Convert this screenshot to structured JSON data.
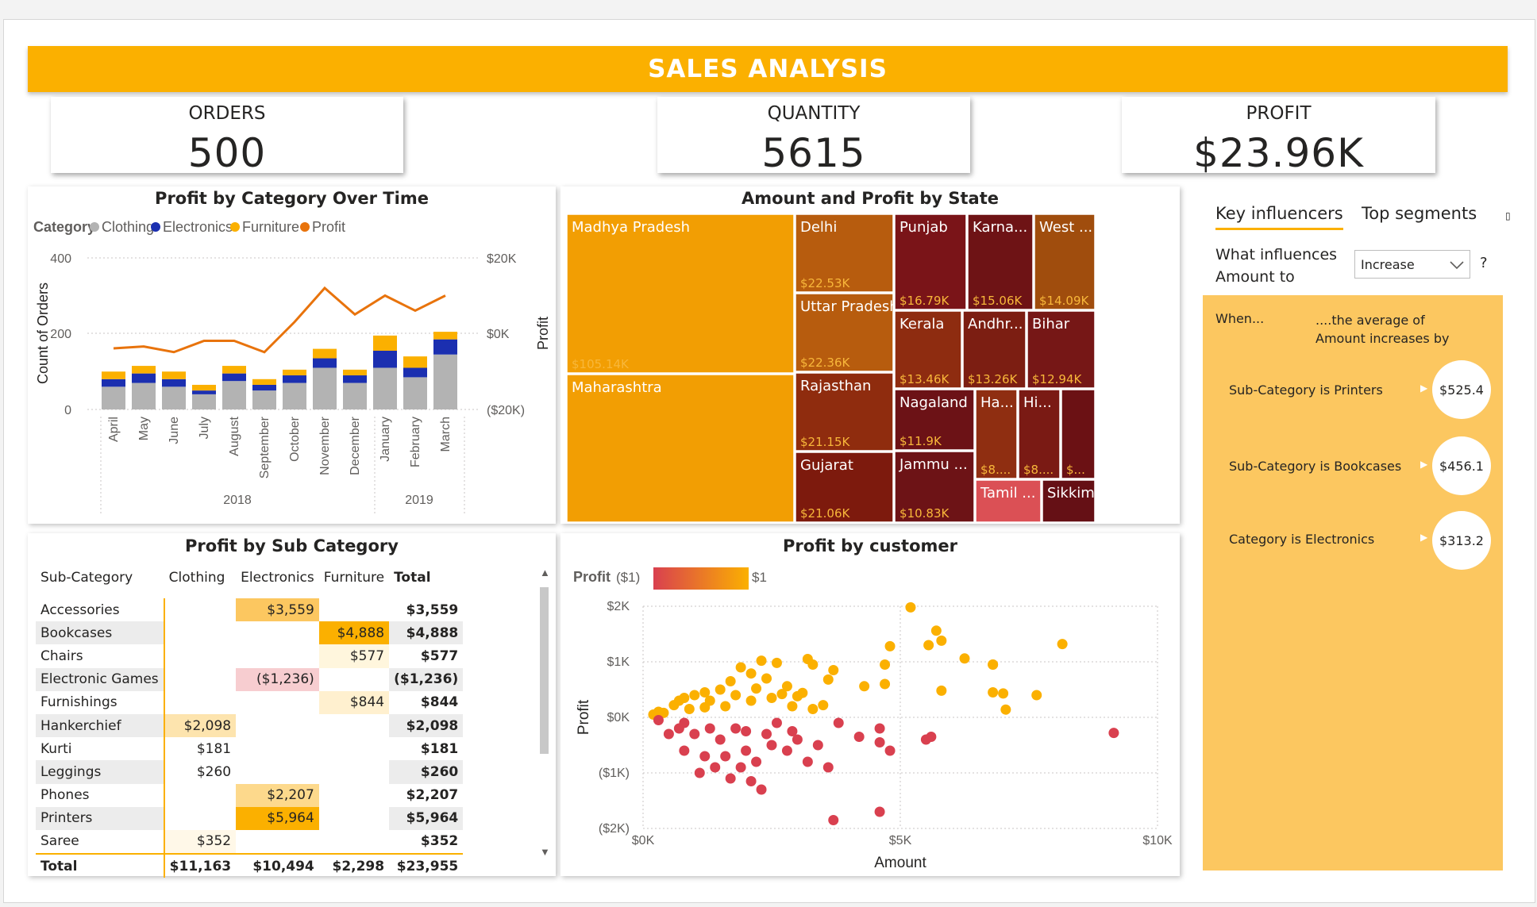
{
  "header": {
    "title": "SALES ANALYSIS"
  },
  "kpis": [
    {
      "label": "ORDERS",
      "value": "500"
    },
    {
      "label": "QUANTITY",
      "value": "5615"
    },
    {
      "label": "PROFIT",
      "value": "$23.96K"
    }
  ],
  "combo_chart": {
    "title": "Profit by Category Over Time",
    "legend_title": "Category",
    "legend": [
      {
        "name": "Clothing",
        "color": "#b3b3b3"
      },
      {
        "name": "Electronics",
        "color": "#1b2fb0"
      },
      {
        "name": "Furniture",
        "color": "#fbb000"
      },
      {
        "name": "Profit",
        "color": "#e8730c"
      }
    ],
    "y_left_label": "Count of Orders",
    "y_right_label": "Profit",
    "y_left_ticks": [
      "400",
      "200",
      "0"
    ],
    "y_right_ticks": [
      "$20K",
      "$0K",
      "($20K)"
    ],
    "years": [
      "2018",
      "2019"
    ]
  },
  "chart_data": [
    {
      "type": "bar",
      "title": "Profit by Category Over Time",
      "stacked": true,
      "categories": [
        "April",
        "May",
        "June",
        "July",
        "August",
        "September",
        "October",
        "November",
        "December",
        "January",
        "February",
        "March"
      ],
      "series": [
        {
          "name": "Clothing",
          "values": [
            60,
            70,
            60,
            40,
            75,
            50,
            70,
            110,
            70,
            110,
            85,
            145
          ]
        },
        {
          "name": "Electronics",
          "values": [
            20,
            25,
            20,
            10,
            20,
            15,
            20,
            25,
            20,
            45,
            25,
            40
          ]
        },
        {
          "name": "Furniture",
          "values": [
            20,
            20,
            20,
            15,
            20,
            15,
            15,
            25,
            15,
            40,
            30,
            20
          ]
        },
        {
          "name": "Profit",
          "values": [
            -4000,
            -3500,
            -5000,
            -2000,
            -2000,
            -5000,
            3000,
            12000,
            5000,
            10000,
            6000,
            10000
          ]
        }
      ],
      "ylim": [
        0,
        400
      ],
      "ylim_right": [
        -20000,
        20000
      ],
      "ylabel": "Count of Orders",
      "ylabel_right": "Profit"
    },
    {
      "type": "scatter",
      "title": "Profit by customer",
      "xlabel": "Amount",
      "ylabel": "Profit",
      "xlim": [
        0,
        10000
      ],
      "ylim": [
        -2000,
        2000
      ],
      "points": [
        [
          5200,
          1980
        ],
        [
          5700,
          1560
        ],
        [
          5800,
          1380
        ],
        [
          5550,
          1300
        ],
        [
          8150,
          1320
        ],
        [
          4800,
          1280
        ],
        [
          6250,
          1060
        ],
        [
          4700,
          950
        ],
        [
          6800,
          950
        ],
        [
          6800,
          950
        ],
        [
          3200,
          1050
        ],
        [
          3300,
          950
        ],
        [
          3700,
          850
        ],
        [
          2300,
          1020
        ],
        [
          2600,
          980
        ],
        [
          1900,
          900
        ],
        [
          3600,
          680
        ],
        [
          4300,
          560
        ],
        [
          4700,
          600
        ],
        [
          5800,
          480
        ],
        [
          6800,
          450
        ],
        [
          7000,
          430
        ],
        [
          7650,
          400
        ],
        [
          7050,
          140
        ],
        [
          3100,
          440
        ],
        [
          2800,
          560
        ],
        [
          2400,
          700
        ],
        [
          2100,
          790
        ],
        [
          1700,
          650
        ],
        [
          1500,
          500
        ],
        [
          1200,
          450
        ],
        [
          1000,
          400
        ],
        [
          800,
          350
        ],
        [
          600,
          220
        ],
        [
          300,
          100
        ],
        [
          200,
          50
        ],
        [
          700,
          300
        ],
        [
          1300,
          300
        ],
        [
          1800,
          400
        ],
        [
          2100,
          300
        ],
        [
          2500,
          350
        ],
        [
          2900,
          200
        ],
        [
          3300,
          150
        ],
        [
          3500,
          220
        ],
        [
          3000,
          380
        ],
        [
          1600,
          200
        ],
        [
          900,
          150
        ],
        [
          400,
          80
        ],
        [
          1200,
          180
        ],
        [
          2200,
          520
        ],
        [
          2700,
          420
        ],
        [
          3800,
          -100
        ],
        [
          4200,
          -350
        ],
        [
          4600,
          -200
        ],
        [
          4800,
          -600
        ],
        [
          5500,
          -400
        ],
        [
          3400,
          -500
        ],
        [
          3200,
          -800
        ],
        [
          3600,
          -900
        ],
        [
          1200,
          -700
        ],
        [
          1400,
          -900
        ],
        [
          1700,
          -1100
        ],
        [
          2000,
          -600
        ],
        [
          1500,
          -400
        ],
        [
          1300,
          -200
        ],
        [
          1000,
          -300
        ],
        [
          800,
          -600
        ],
        [
          1100,
          -1000
        ],
        [
          1900,
          -900
        ],
        [
          2200,
          -800
        ],
        [
          2800,
          -600
        ],
        [
          3000,
          -400
        ],
        [
          2400,
          -300
        ],
        [
          2600,
          -100
        ],
        [
          1800,
          -200
        ],
        [
          800,
          -100
        ],
        [
          500,
          -300
        ],
        [
          300,
          -50
        ],
        [
          1600,
          -700
        ],
        [
          2100,
          -1150
        ],
        [
          2300,
          -1300
        ],
        [
          2500,
          -500
        ],
        [
          2900,
          -250
        ],
        [
          2000,
          -250
        ],
        [
          700,
          -200
        ],
        [
          3700,
          -1850
        ],
        [
          4600,
          -1700
        ],
        [
          5600,
          -350
        ],
        [
          9150,
          -280
        ],
        [
          4600,
          -450
        ]
      ]
    }
  ],
  "treemap": {
    "title": "Amount and Profit by State",
    "tiles": [
      {
        "name": "Madhya Pradesh",
        "value": "$105.14K",
        "color": "#f29e03"
      },
      {
        "name": "Maharashtra",
        "value": "",
        "color": "#f29e03"
      },
      {
        "name": "Delhi",
        "value": "$22.53K",
        "color": "#b75c0e"
      },
      {
        "name": "Uttar Pradesh",
        "value": "$22.36K",
        "color": "#b75c0e"
      },
      {
        "name": "Rajasthan",
        "value": "$21.15K",
        "color": "#8f2c0e"
      },
      {
        "name": "Gujarat",
        "value": "$21.06K",
        "color": "#7d1a0d"
      },
      {
        "name": "Punjab",
        "value": "$16.79K",
        "color": "#7a1418"
      },
      {
        "name": "Karna...",
        "value": "$15.06K",
        "color": "#6e1315"
      },
      {
        "name": "West ...",
        "value": "$14.09K",
        "color": "#a04d0d"
      },
      {
        "name": "Kerala",
        "value": "$13.46K",
        "color": "#8e2c10"
      },
      {
        "name": "Andhr...",
        "value": "$13.26K",
        "color": "#7c1e12"
      },
      {
        "name": "Bihar",
        "value": "$12.94K",
        "color": "#761716"
      },
      {
        "name": "Nagaland",
        "value": "$11.9K",
        "color": "#6c1216"
      },
      {
        "name": "Jammu ...",
        "value": "$10.83K",
        "color": "#6d1316"
      },
      {
        "name": "Ha...",
        "value": "$8....",
        "color": "#8f2e11"
      },
      {
        "name": "Hi...",
        "value": "$8....",
        "color": "#7a1a14"
      },
      {
        "name": "",
        "value": "$...",
        "color": "#6b1114"
      },
      {
        "name": "Tamil ...",
        "value": "",
        "color": "#db5055"
      },
      {
        "name": "Sikkim",
        "value": "",
        "color": "#651015"
      }
    ]
  },
  "subcat": {
    "title": "Profit by Sub Category",
    "headers": [
      "Sub-Category",
      "Clothing",
      "Electronics",
      "Furniture",
      "Total"
    ],
    "rows": [
      {
        "name": "Accessories",
        "clothing": "",
        "electronics": "$3,559",
        "furniture": "",
        "total": "$3,559"
      },
      {
        "name": "Bookcases",
        "clothing": "",
        "electronics": "",
        "furniture": "$4,888",
        "total": "$4,888"
      },
      {
        "name": "Chairs",
        "clothing": "",
        "electronics": "",
        "furniture": "$577",
        "total": "$577"
      },
      {
        "name": "Electronic Games",
        "clothing": "",
        "electronics": "($1,236)",
        "furniture": "",
        "total": "($1,236)"
      },
      {
        "name": "Furnishings",
        "clothing": "",
        "electronics": "",
        "furniture": "$844",
        "total": "$844"
      },
      {
        "name": "Hankerchief",
        "clothing": "$2,098",
        "electronics": "",
        "furniture": "",
        "total": "$2,098"
      },
      {
        "name": "Kurti",
        "clothing": "$181",
        "electronics": "",
        "furniture": "",
        "total": "$181"
      },
      {
        "name": "Leggings",
        "clothing": "$260",
        "electronics": "",
        "furniture": "",
        "total": "$260"
      },
      {
        "name": "Phones",
        "clothing": "",
        "electronics": "$2,207",
        "furniture": "",
        "total": "$2,207"
      },
      {
        "name": "Printers",
        "clothing": "",
        "electronics": "$5,964",
        "furniture": "",
        "total": "$5,964"
      },
      {
        "name": "Saree",
        "clothing": "$352",
        "electronics": "",
        "furniture": "",
        "total": "$352"
      }
    ],
    "total": {
      "name": "Total",
      "clothing": "$11,163",
      "electronics": "$10,494",
      "furniture": "$2,298",
      "total": "$23,955"
    }
  },
  "scatter": {
    "title": "Profit by customer",
    "legend_label": "Profit",
    "legend_min": "($1)",
    "legend_max": "$1",
    "y_ticks": [
      "$2K",
      "$1K",
      "$0K",
      "($1K)",
      "($2K)"
    ],
    "x_ticks": [
      "$0K",
      "$5K",
      "$10K"
    ],
    "xlabel": "Amount",
    "ylabel": "Profit"
  },
  "key_influencers": {
    "tab1": "Key influencers",
    "tab2": "Top segments",
    "question": "What influences Amount to",
    "dropdown_value": "Increase",
    "help": "?",
    "when": "When...",
    "avg_text": "....the average of Amount increases by",
    "items": [
      {
        "label": "Sub-Category is Printers",
        "value": "$525.4"
      },
      {
        "label": "Sub-Category is Bookcases",
        "value": "$456.1"
      },
      {
        "label": "Category is Electronics",
        "value": "$313.2"
      }
    ]
  }
}
